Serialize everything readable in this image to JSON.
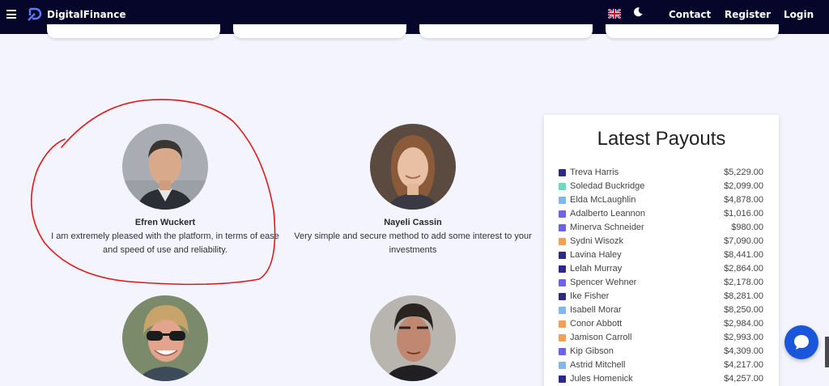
{
  "nav": {
    "brand": "DigitalFinance",
    "contact": "Contact",
    "register": "Register",
    "login": "Login",
    "icons": [
      "hamburger-icon",
      "logo-icon",
      "uk-flag-icon",
      "moon-icon"
    ]
  },
  "testimonials": [
    {
      "name": "Efren Wuckert",
      "text": "I am extremely pleased with the platform, in terms of ease and speed of use and reliability."
    },
    {
      "name": "Nayeli Cassin",
      "text": "Very simple and secure method to add some interest to your investments"
    }
  ],
  "payouts": {
    "title": "Latest Payouts",
    "rows": [
      {
        "name": "Treva Harris",
        "amount": "$5,229.00",
        "color": "#2d2a86"
      },
      {
        "name": "Soledad Buckridge",
        "amount": "$2,099.00",
        "color": "#6fd6c0"
      },
      {
        "name": "Elda McLaughlin",
        "amount": "$4,878.00",
        "color": "#7eb8ef"
      },
      {
        "name": "Adalberto Leannon",
        "amount": "$1,016.00",
        "color": "#6c63e6"
      },
      {
        "name": "Minerva Schneider",
        "amount": "$980.00",
        "color": "#6c63e6"
      },
      {
        "name": "Sydni Wisozk",
        "amount": "$7,090.00",
        "color": "#f0a05a"
      },
      {
        "name": "Lavina Haley",
        "amount": "$8,441.00",
        "color": "#2d2a86"
      },
      {
        "name": "Lelah Murray",
        "amount": "$2,864.00",
        "color": "#2d2a86"
      },
      {
        "name": "Spencer Wehner",
        "amount": "$2,178.00",
        "color": "#6c63e6"
      },
      {
        "name": "Ike Fisher",
        "amount": "$8,281.00",
        "color": "#2d2a86"
      },
      {
        "name": "Isabell Morar",
        "amount": "$8,250.00",
        "color": "#7eb8ef"
      },
      {
        "name": "Conor Abbott",
        "amount": "$2,984.00",
        "color": "#f0a05a"
      },
      {
        "name": "Jamison Carroll",
        "amount": "$2,993.00",
        "color": "#f0a05a"
      },
      {
        "name": "Kip Gibson",
        "amount": "$4,309.00",
        "color": "#6c63e6"
      },
      {
        "name": "Astrid Mitchell",
        "amount": "$4,217.00",
        "color": "#7eb8ef"
      },
      {
        "name": "Jules Homenick",
        "amount": "$4,257.00",
        "color": "#2d2a86"
      }
    ]
  },
  "chat": {
    "icon": "chat-bubble-icon"
  }
}
